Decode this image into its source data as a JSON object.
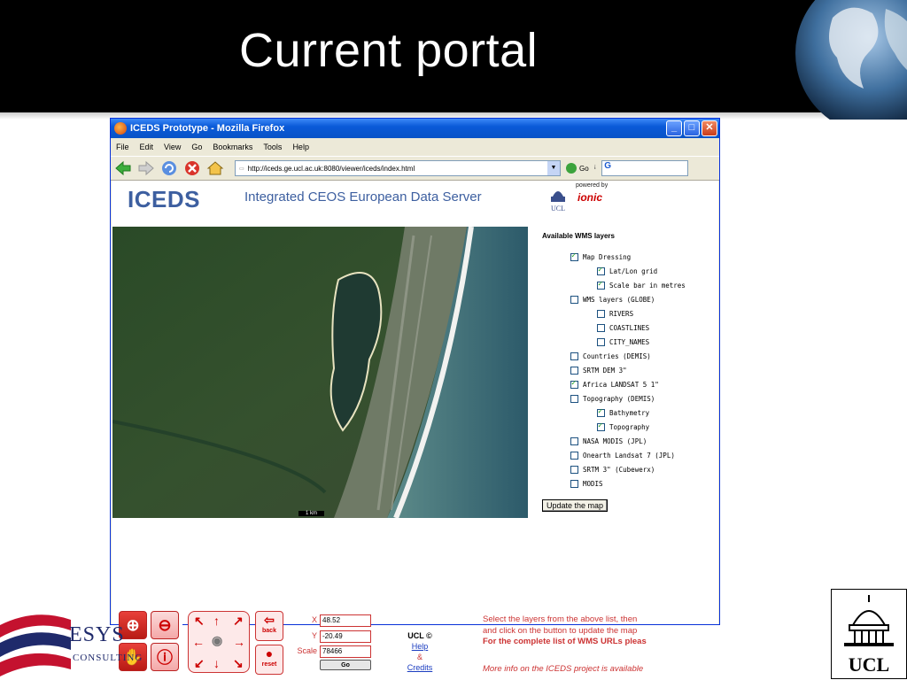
{
  "slide": {
    "title": "Current portal"
  },
  "browser": {
    "window_title": "ICEDS Prototype - Mozilla Firefox",
    "menu": [
      "File",
      "Edit",
      "View",
      "Go",
      "Bookmarks",
      "Tools",
      "Help"
    ],
    "url": "http://iceds.ge.ucl.ac.uk:8080/viewer/iceds/index.html",
    "go_label": "Go",
    "search_value": "G"
  },
  "page": {
    "logo": "ICEDS",
    "subtitle": "Integrated CEOS European Data Server",
    "powered_by": "powered by",
    "ionic": "ionic",
    "ucl_mark": "UCL",
    "map_scale": "1 km",
    "layers_heading": "Available WMS layers",
    "layers": [
      {
        "label": "Map Dressing",
        "checked": true,
        "level": 1
      },
      {
        "label": "Lat/Lon grid",
        "checked": true,
        "level": 2
      },
      {
        "label": "Scale bar in metres",
        "checked": true,
        "level": 2
      },
      {
        "label": "WMS layers (GLOBE)",
        "checked": false,
        "level": 1
      },
      {
        "label": "RIVERS",
        "checked": false,
        "level": 2
      },
      {
        "label": "COASTLINES",
        "checked": false,
        "level": 2
      },
      {
        "label": "CITY_NAMES",
        "checked": false,
        "level": 2
      },
      {
        "label": "Countries (DEMIS)",
        "checked": false,
        "level": 1
      },
      {
        "label": "SRTM DEM 3\"",
        "checked": false,
        "level": 1
      },
      {
        "label": "Africa LANDSAT 5 1\"",
        "checked": true,
        "level": 1
      },
      {
        "label": "Topography (DEMIS)",
        "checked": false,
        "level": 1
      },
      {
        "label": "Bathymetry",
        "checked": true,
        "level": 2
      },
      {
        "label": "Topography",
        "checked": true,
        "level": 2
      },
      {
        "label": "NASA MODIS (JPL)",
        "checked": false,
        "level": 1
      },
      {
        "label": "Onearth Landsat 7 (JPL)",
        "checked": false,
        "level": 1
      },
      {
        "label": "SRTM 3\" (Cubewerx)",
        "checked": false,
        "level": 1
      },
      {
        "label": "MODIS",
        "checked": false,
        "level": 1
      }
    ],
    "update_button": "Update the map",
    "controls": {
      "back": "back",
      "reset": "reset",
      "x_label": "X",
      "y_label": "Y",
      "scale_label": "Scale",
      "x_value": "48.52",
      "y_value": "-20.49",
      "scale_value": "78466",
      "go": "Go"
    },
    "credits": {
      "ucl": "UCL ©",
      "help": "Help",
      "amp": "&",
      "credits": "Credits"
    },
    "info": {
      "line1": "Select the layers from the above list, then",
      "line2": "and click on the button to update the map",
      "line3": "For the complete list of WMS URLs pleas",
      "line4": "More info on the ICEDS project is available"
    }
  },
  "footer": {
    "esys": "ESYS",
    "esys_sub": "CONSULTING",
    "ucl": "UCL"
  },
  "colors": {
    "title_band": "#000000",
    "browser_title": "#0a5ad8",
    "accent_red": "#cc3333",
    "iceds_blue": "#3d5fa0"
  }
}
